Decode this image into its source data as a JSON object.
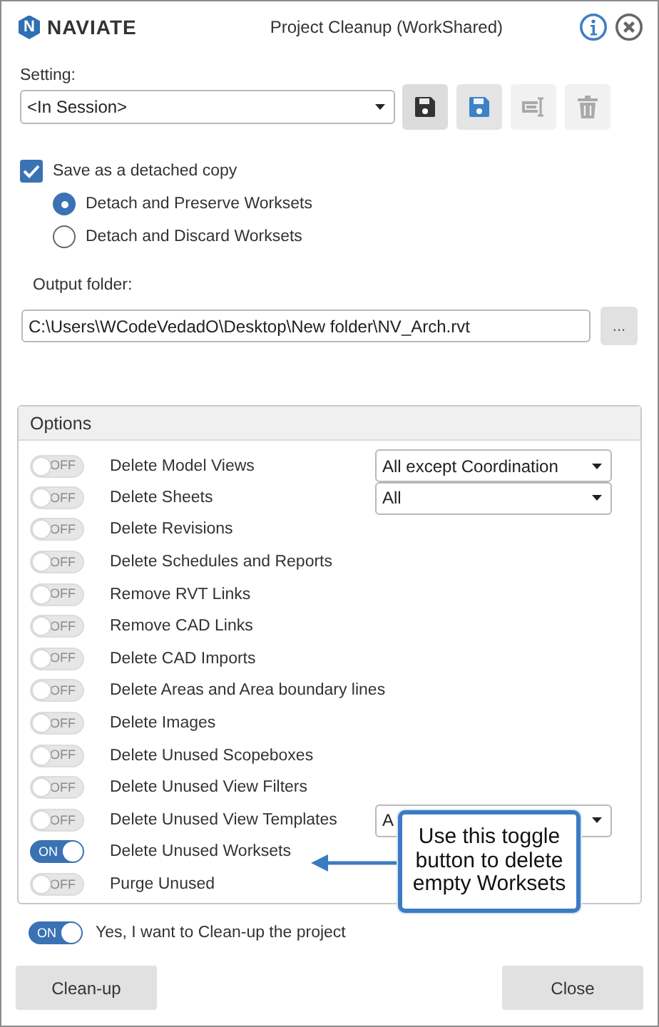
{
  "header": {
    "logo_mark": "N",
    "brand": "NAVIATE",
    "title": "Project Cleanup (WorkShared)"
  },
  "setting": {
    "label": "Setting:",
    "value": "<In Session>"
  },
  "toolbar": [
    {
      "kind": "save",
      "disabled": false
    },
    {
      "kind": "save-as",
      "disabled": false
    },
    {
      "kind": "rename",
      "disabled": true
    },
    {
      "kind": "delete",
      "disabled": true
    }
  ],
  "detach": {
    "label": "Save as a detached copy",
    "checked": true,
    "options": [
      {
        "label": "Detach and Preserve Worksets",
        "selected": true
      },
      {
        "label": "Detach and Discard Worksets",
        "selected": false
      }
    ]
  },
  "output": {
    "label": "Output folder:",
    "value": "C:\\Users\\WCodeVedadO\\Desktop\\New folder\\NV_Arch.rvt",
    "browse": "..."
  },
  "options": {
    "title": "Options",
    "rows": [
      {
        "label": "Delete Model Views",
        "on": false,
        "switch_text": "OFF",
        "dropdown": "All except Coordination"
      },
      {
        "label": "Delete Sheets",
        "on": false,
        "switch_text": "OFF",
        "dropdown": "All"
      },
      {
        "label": "Delete Revisions",
        "on": false,
        "switch_text": "OFF"
      },
      {
        "label": "Delete Schedules and Reports",
        "on": false,
        "switch_text": "OFF"
      },
      {
        "label": "Remove RVT Links",
        "on": false,
        "switch_text": "OFF"
      },
      {
        "label": "Remove CAD Links",
        "on": false,
        "switch_text": "OFF"
      },
      {
        "label": "Delete CAD Imports",
        "on": false,
        "switch_text": "OFF"
      },
      {
        "label": "Delete Areas and Area boundary lines",
        "on": false,
        "switch_text": "OFF"
      },
      {
        "label": "Delete Images",
        "on": false,
        "switch_text": "OFF"
      },
      {
        "label": "Delete Unused Scopeboxes",
        "on": false,
        "switch_text": "OFF"
      },
      {
        "label": "Delete Unused View Filters",
        "on": false,
        "switch_text": "OFF"
      },
      {
        "label": "Delete Unused View Templates",
        "on": false,
        "switch_text": "OFF",
        "dropdown": "A"
      },
      {
        "label": "Delete Unused Worksets",
        "on": true,
        "switch_text": "ON"
      },
      {
        "label": "Purge Unused",
        "on": false,
        "switch_text": "OFF"
      }
    ]
  },
  "callout": {
    "text": "Use this toggle button to delete empty Worksets"
  },
  "confirm": {
    "label": "Yes, I want to Clean-up the project",
    "on": true,
    "switch_text": "ON"
  },
  "buttons": [
    "Clean-up",
    "Close"
  ]
}
